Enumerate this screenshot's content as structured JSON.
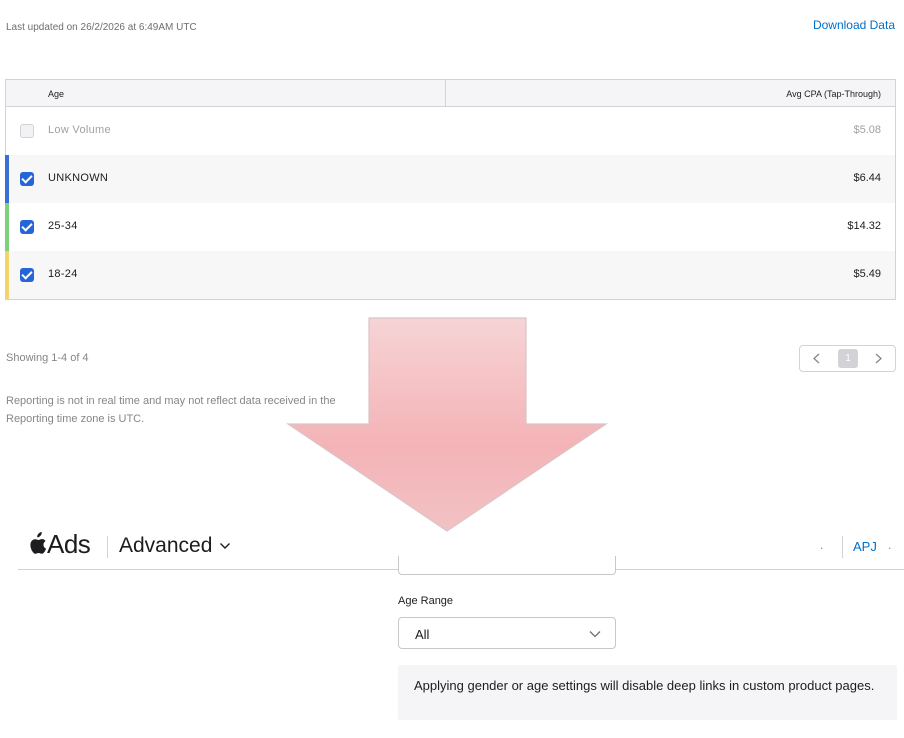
{
  "report": {
    "last_updated": "Last updated on 26/2/2026 at 6:49AM UTC",
    "download_label": "Download Data",
    "table": {
      "headers": {
        "age": "Age",
        "cpa": "Avg CPA (Tap-Through)"
      },
      "rows": [
        {
          "label": "Low Volume",
          "value": "$5.08",
          "checked": false,
          "disabled": true,
          "color": ""
        },
        {
          "label": "UNKNOWN",
          "value": "$6.44",
          "checked": true,
          "disabled": false,
          "color": "#3b6fd6"
        },
        {
          "label": "25-34",
          "value": "$14.32",
          "checked": true,
          "disabled": false,
          "color": "#7ed07b"
        },
        {
          "label": "18-24",
          "value": "$5.49",
          "checked": true,
          "disabled": false,
          "color": "#f3d36a"
        }
      ]
    },
    "showing": "Showing 1-4 of 4",
    "pagination": {
      "current_page": "1",
      "prev_icon": "chevron-left-icon",
      "next_icon": "chevron-right-icon"
    },
    "note_line1": "Reporting is not in real time and may not reflect data received in the",
    "note_line2": "Reporting time zone is UTC."
  },
  "overlay": {
    "icon": "down-arrow-icon",
    "color": "#f2a9ad"
  },
  "appbar": {
    "logo_icon": "apple-logo-icon",
    "brand": "Ads",
    "section": "Advanced",
    "section_icon": "chevron-down-icon",
    "dot_left": ".",
    "account_label": "APJ",
    "dot_right": "."
  },
  "targeting": {
    "age_range_label": "Age Range",
    "age_range_value": "All",
    "select_icon": "chevron-down-icon",
    "notice": "Applying gender or age settings will disable deep links in custom product pages."
  },
  "colors": {
    "accent": "#0070c9",
    "checkbox": "#2466d8"
  }
}
